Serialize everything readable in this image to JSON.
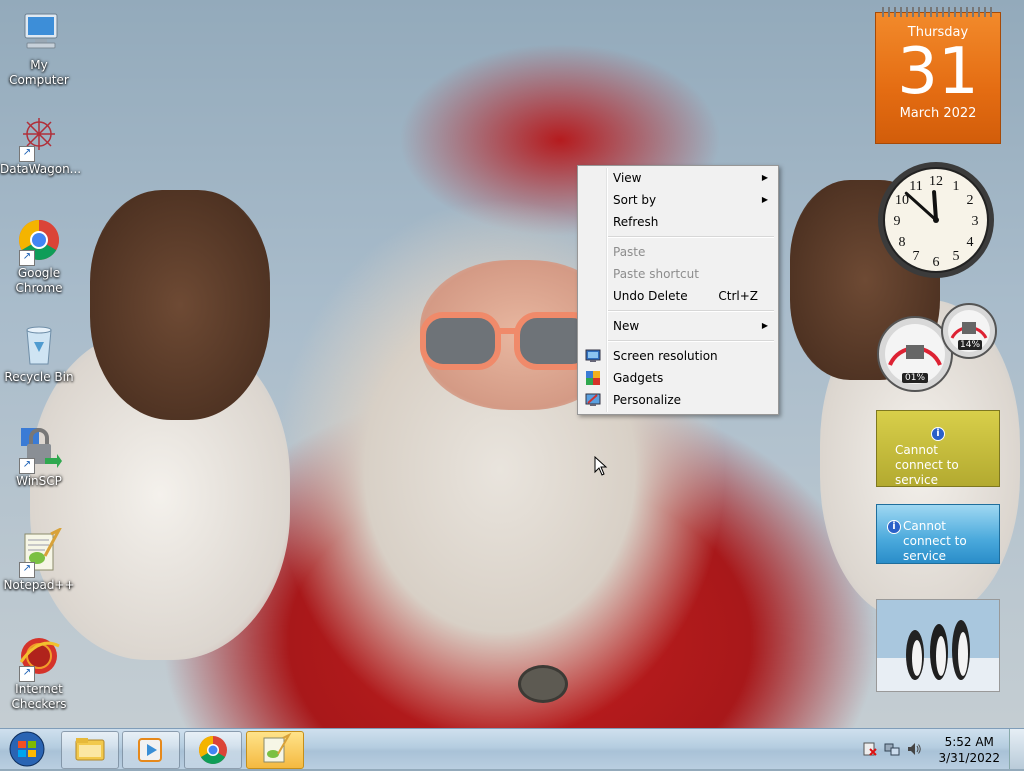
{
  "desktop": {
    "icons": [
      {
        "label": "My Computer",
        "icon": "computer-icon"
      },
      {
        "label": "DataWagon...",
        "icon": "datawagon-icon"
      },
      {
        "label": "Google Chrome",
        "icon": "chrome-icon"
      },
      {
        "label": "Recycle Bin",
        "icon": "recycle-bin-icon"
      },
      {
        "label": "WinSCP",
        "icon": "winscp-icon"
      },
      {
        "label": "Notepad++",
        "icon": "notepadpp-icon"
      },
      {
        "label": "Internet Checkers",
        "icon": "internet-checkers-icon"
      }
    ]
  },
  "context_menu": {
    "items": [
      {
        "label": "View",
        "submenu": true
      },
      {
        "label": "Sort by",
        "submenu": true
      },
      {
        "label": "Refresh"
      },
      {
        "label": "Paste",
        "disabled": true
      },
      {
        "label": "Paste shortcut",
        "disabled": true
      },
      {
        "label": "Undo Delete",
        "shortcut": "Ctrl+Z"
      },
      {
        "label": "New",
        "submenu": true
      },
      {
        "label": "Screen resolution",
        "icon": "screen-resolution-icon"
      },
      {
        "label": "Gadgets",
        "icon": "gadgets-icon"
      },
      {
        "label": "Personalize",
        "icon": "personalize-icon"
      }
    ]
  },
  "gadgets": {
    "calendar": {
      "weekday": "Thursday",
      "day": "31",
      "month_year": "March 2022"
    },
    "clock": {
      "hour": 11,
      "minute": 52
    },
    "cpu_meter": {
      "cpu": "01%",
      "memory": "14%"
    },
    "weather": {
      "message": "Cannot connect to service"
    },
    "currency": {
      "message": "Cannot connect to service"
    }
  },
  "taskbar": {
    "apps": [
      "windows-explorer-icon",
      "media-player-icon",
      "chrome-icon",
      "notepadpp-icon"
    ],
    "clock": {
      "time": "5:52 AM",
      "date": "3/31/2022"
    }
  },
  "colors": {
    "calendar_orange": "#e46c12",
    "taskbar": "#b5cde0",
    "menu_bg": "#f1f1f1"
  }
}
